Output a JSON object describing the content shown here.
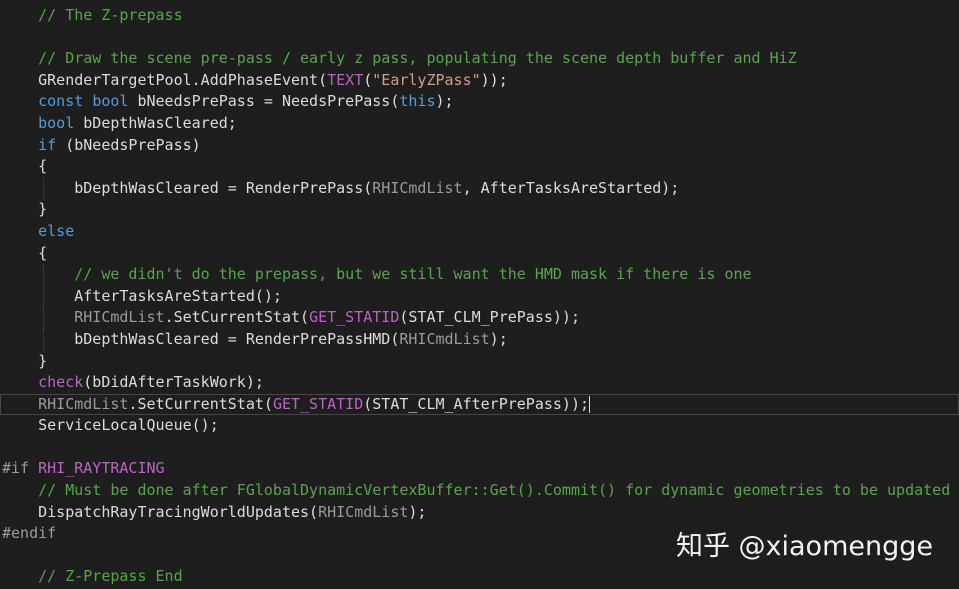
{
  "editor": {
    "lines": [
      {
        "name": "line-comment-zprepass",
        "tokens": [
          {
            "t": "    // The Z-prepass",
            "c": "comment"
          }
        ]
      },
      {
        "name": "line-blank",
        "tokens": []
      },
      {
        "name": "line-comment-draw",
        "tokens": [
          {
            "t": "    // Draw the scene pre-pass / early z pass, populating the scene depth buffer and HiZ",
            "c": "comment"
          }
        ]
      },
      {
        "name": "line-add-phase-event",
        "tokens": [
          {
            "t": "    GRenderTargetPool.AddPhaseEvent(",
            "c": "plain"
          },
          {
            "t": "TEXT",
            "c": "macro"
          },
          {
            "t": "(",
            "c": "plain"
          },
          {
            "t": "\"EarlyZPass\"",
            "c": "str"
          },
          {
            "t": "));",
            "c": "plain"
          }
        ]
      },
      {
        "name": "line-const-bool",
        "tokens": [
          {
            "t": "    ",
            "c": "plain"
          },
          {
            "t": "const",
            "c": "kw"
          },
          {
            "t": " ",
            "c": "plain"
          },
          {
            "t": "bool",
            "c": "kw"
          },
          {
            "t": " bNeedsPrePass = NeedsPrePass(",
            "c": "plain"
          },
          {
            "t": "this",
            "c": "kw"
          },
          {
            "t": ");",
            "c": "plain"
          }
        ]
      },
      {
        "name": "line-bool-depth",
        "tokens": [
          {
            "t": "    ",
            "c": "plain"
          },
          {
            "t": "bool",
            "c": "kw"
          },
          {
            "t": " bDepthWasCleared;",
            "c": "plain"
          }
        ]
      },
      {
        "name": "line-if",
        "tokens": [
          {
            "t": "    ",
            "c": "plain"
          },
          {
            "t": "if",
            "c": "kw"
          },
          {
            "t": " (bNeedsPrePass)",
            "c": "plain"
          }
        ]
      },
      {
        "name": "line-open-brace",
        "tokens": [
          {
            "t": "    {",
            "c": "plain"
          }
        ]
      },
      {
        "name": "line-render-prepass",
        "tokens": [
          {
            "t": "        bDepthWasCleared = RenderPrePass(",
            "c": "plain"
          },
          {
            "t": "RHICmdList",
            "c": "param"
          },
          {
            "t": ", AfterTasksAreStarted);",
            "c": "plain"
          }
        ]
      },
      {
        "name": "line-close-brace",
        "tokens": [
          {
            "t": "    }",
            "c": "plain"
          }
        ]
      },
      {
        "name": "line-else",
        "tokens": [
          {
            "t": "    ",
            "c": "plain"
          },
          {
            "t": "else",
            "c": "kw"
          }
        ]
      },
      {
        "name": "line-open-brace",
        "tokens": [
          {
            "t": "    {",
            "c": "plain"
          }
        ]
      },
      {
        "name": "line-comment-hmd",
        "tokens": [
          {
            "t": "        // we didn't do the prepass, but we still want the HMD mask if there is one",
            "c": "comment"
          }
        ]
      },
      {
        "name": "line-after-tasks",
        "tokens": [
          {
            "t": "        AfterTasksAreStarted();",
            "c": "plain"
          }
        ]
      },
      {
        "name": "line-set-stat-prepass",
        "tokens": [
          {
            "t": "        ",
            "c": "plain"
          },
          {
            "t": "RHICmdList",
            "c": "param"
          },
          {
            "t": ".SetCurrentStat(",
            "c": "plain"
          },
          {
            "t": "GET_STATID",
            "c": "macro"
          },
          {
            "t": "(STAT_CLM_PrePass));",
            "c": "plain"
          }
        ]
      },
      {
        "name": "line-render-prepass-hmd",
        "tokens": [
          {
            "t": "        bDepthWasCleared = RenderPrePassHMD(",
            "c": "plain"
          },
          {
            "t": "RHICmdList",
            "c": "param"
          },
          {
            "t": ");",
            "c": "plain"
          }
        ]
      },
      {
        "name": "line-close-brace",
        "tokens": [
          {
            "t": "    }",
            "c": "plain"
          }
        ]
      },
      {
        "name": "line-check",
        "tokens": [
          {
            "t": "    ",
            "c": "plain"
          },
          {
            "t": "check",
            "c": "macro"
          },
          {
            "t": "(bDidAfterTaskWork);",
            "c": "plain"
          }
        ]
      },
      {
        "name": "line-set-stat-afterprepass",
        "current": true,
        "tokens": [
          {
            "t": "    ",
            "c": "plain"
          },
          {
            "t": "RHICmdList",
            "c": "param"
          },
          {
            "t": ".SetCurrentStat(",
            "c": "plain"
          },
          {
            "t": "GET_STATID",
            "c": "macro"
          },
          {
            "t": "(STAT_CLM_AfterPrePass));",
            "c": "plain"
          }
        ]
      },
      {
        "name": "line-service-queue",
        "tokens": [
          {
            "t": "    ServiceLocalQueue();",
            "c": "plain"
          }
        ]
      },
      {
        "name": "line-blank",
        "tokens": []
      },
      {
        "name": "line-if-raytracing",
        "tokens": [
          {
            "t": "#if",
            "c": "pp"
          },
          {
            "t": " ",
            "c": "plain"
          },
          {
            "t": "RHI_RAYTRACING",
            "c": "macro"
          }
        ]
      },
      {
        "name": "line-comment-raytracing",
        "tokens": [
          {
            "t": "    // Must be done after FGlobalDynamicVertexBuffer::Get().Commit() for dynamic geometries to be updated",
            "c": "comment"
          }
        ]
      },
      {
        "name": "line-dispatch-raytracing",
        "tokens": [
          {
            "t": "    DispatchRayTracingWorldUpdates(",
            "c": "plain"
          },
          {
            "t": "RHICmdList",
            "c": "param"
          },
          {
            "t": ");",
            "c": "plain"
          }
        ]
      },
      {
        "name": "line-endif",
        "tokens": [
          {
            "t": "#endif",
            "c": "pp"
          }
        ]
      },
      {
        "name": "line-blank",
        "tokens": []
      },
      {
        "name": "line-comment-end",
        "tokens": [
          {
            "t": "    // Z-Prepass End",
            "c": "comment"
          }
        ]
      }
    ]
  },
  "watermark": {
    "text": "知乎 @xiaomengge"
  },
  "colors": {
    "background": "#1e1e1e",
    "comment": "#57a64a",
    "keyword": "#569cd6",
    "macro": "#bd63c5",
    "string": "#d69d85",
    "parameter": "#9a9a9a",
    "plain": "#dcdcdc"
  }
}
